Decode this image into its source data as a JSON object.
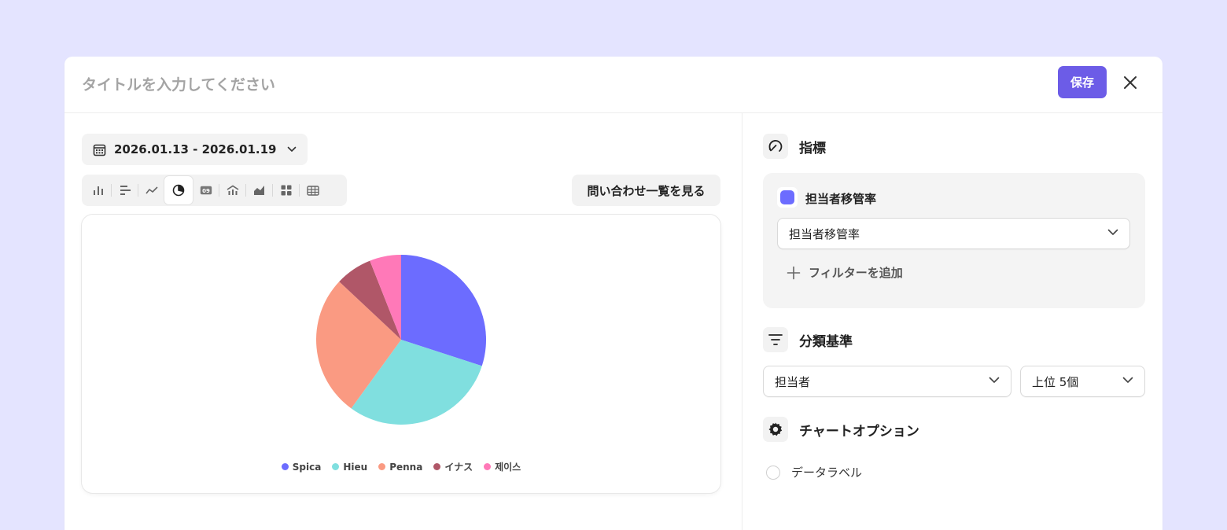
{
  "header": {
    "title_placeholder": "タイトルを入力してください",
    "save_label": "保存"
  },
  "date_range": "2026.01.13 - 2026.01.19",
  "toolbar": {
    "chart_types": [
      "vertical-bar",
      "horizontal-bar",
      "line",
      "pie",
      "number",
      "funnel",
      "area",
      "grid",
      "table"
    ],
    "active": "pie"
  },
  "inquiry_button": "問い合わせ一覧を見る",
  "chart_data": {
    "type": "pie",
    "categories": [
      "Spica",
      "Hieu",
      "Penna",
      "イナス",
      "제이스"
    ],
    "values": [
      30,
      30,
      27,
      7,
      6
    ],
    "colors": [
      "#6c6cff",
      "#80dfdf",
      "#fa9a82",
      "#b05768",
      "#ff79b8"
    ],
    "legend_position": "bottom"
  },
  "metrics": {
    "title": "指標",
    "metric_name": "担当者移管率",
    "metric_select": "担当者移管率",
    "add_filter": "フィルターを追加"
  },
  "classification": {
    "title": "分類基準",
    "group_by": "担当者",
    "limit": "上位 5個"
  },
  "chart_options": {
    "title": "チャートオプション",
    "data_label": "データラベル"
  },
  "colors": {
    "accent": "#6c5ce7",
    "background": "#e4e4ff"
  }
}
